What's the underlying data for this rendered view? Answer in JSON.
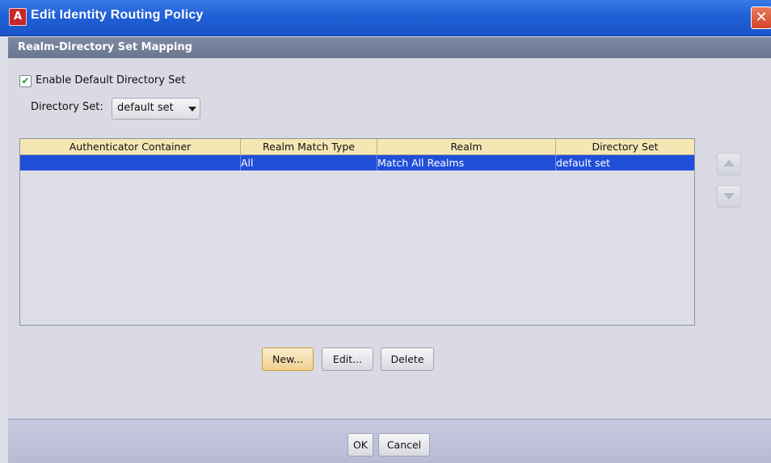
{
  "window": {
    "title": "Edit Identity Routing Policy",
    "logo_letter": "A",
    "close_glyph": "✕"
  },
  "section": {
    "title": "Realm-Directory Set Mapping"
  },
  "enable_default": {
    "label": "Enable Default Directory Set",
    "checked": true,
    "check_glyph": "✔"
  },
  "directory_set": {
    "label": "Directory Set:",
    "value": "default set"
  },
  "table": {
    "columns": [
      "Authenticator Container",
      "Realm Match Type",
      "Realm",
      "Directory Set"
    ],
    "rows": [
      {
        "authenticator_container": "",
        "realm_match_type": "All",
        "realm": "Match All Realms",
        "directory_set": "default set",
        "selected": true
      }
    ]
  },
  "row_actions": {
    "new_label": "New...",
    "edit_label": "Edit...",
    "delete_label": "Delete"
  },
  "dialog_actions": {
    "ok_label": "OK",
    "cancel_label": "Cancel"
  },
  "colors": {
    "titlebar": "#1f5fd6",
    "header_band": "#6a7690",
    "table_header": "#f5e7b4",
    "selection": "#1f4fd9",
    "primary_button": "#efcf8e"
  }
}
